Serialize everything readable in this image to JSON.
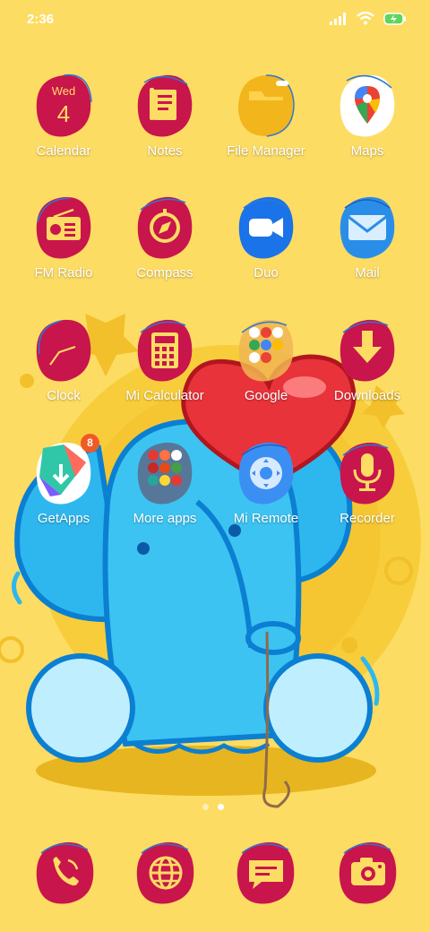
{
  "status_bar": {
    "time": "2:36"
  },
  "calendar": {
    "weekday": "Wed",
    "day": "4"
  },
  "apps": [
    {
      "label": "Calendar"
    },
    {
      "label": "Notes"
    },
    {
      "label": "File Manager"
    },
    {
      "label": "Maps"
    },
    {
      "label": "FM Radio"
    },
    {
      "label": "Compass"
    },
    {
      "label": "Duo"
    },
    {
      "label": "Mail"
    },
    {
      "label": "Clock"
    },
    {
      "label": "Mi Calculator"
    },
    {
      "label": "Google"
    },
    {
      "label": "Downloads"
    },
    {
      "label": "GetApps"
    },
    {
      "label": "More apps"
    },
    {
      "label": "Mi Remote"
    },
    {
      "label": "Recorder"
    }
  ],
  "getapps_badge": "8",
  "dock": [
    {
      "icon": "phone-icon"
    },
    {
      "icon": "browser-globe-icon"
    },
    {
      "icon": "messages-icon"
    },
    {
      "icon": "camera-icon"
    }
  ],
  "page_indicator": {
    "pages": 2,
    "current": 2
  },
  "colors": {
    "wallpaper": "#fddc63",
    "icon_blob": "#c8154c",
    "icon_fg": "#fddc63",
    "label": "#ffffff"
  }
}
